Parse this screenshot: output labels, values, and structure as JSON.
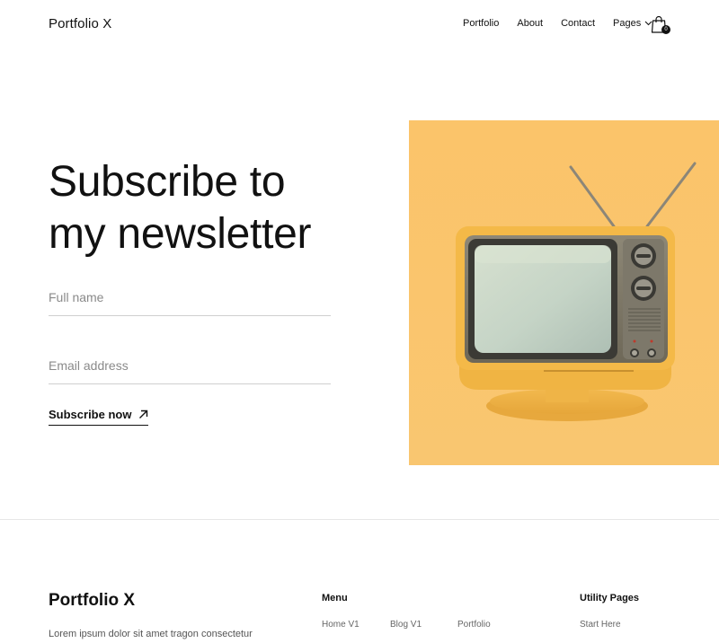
{
  "header": {
    "logo": "Portfolio X",
    "nav": [
      "Portfolio",
      "About",
      "Contact"
    ],
    "pages_label": "Pages",
    "cart_count": "0"
  },
  "hero": {
    "title_line1": "Subscribe to",
    "title_line2": "my newsletter",
    "name_placeholder": "Full name",
    "email_placeholder": "Email address",
    "subscribe_label": "Subscribe now"
  },
  "footer": {
    "logo": "Portfolio X",
    "description": "Lorem ipsum dolor sit amet tragon consectetur",
    "menu_heading": "Menu",
    "menu_links": [
      "Home V1",
      "Blog V1",
      "Portfolio"
    ],
    "utility_heading": "Utility Pages",
    "utility_links": [
      "Start Here"
    ]
  },
  "colors": {
    "accent_background": "#fbc56a",
    "text": "#111111"
  }
}
